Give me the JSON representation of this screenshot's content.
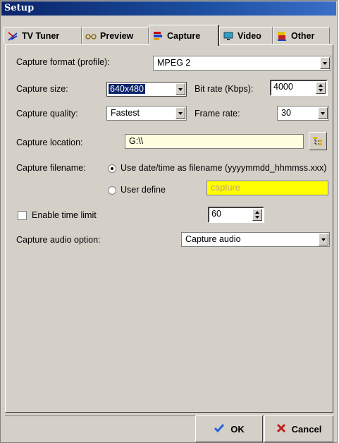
{
  "window": {
    "title": "Setup"
  },
  "tabs": [
    {
      "label": "TV Tuner",
      "icon": "antenna-icon"
    },
    {
      "label": "Preview",
      "icon": "glasses-icon"
    },
    {
      "label": "Capture",
      "icon": "capture-icon"
    },
    {
      "label": "Video",
      "icon": "monitor-icon"
    },
    {
      "label": "Other",
      "icon": "other-icon"
    }
  ],
  "active_tab": "Capture",
  "capture": {
    "format_label": "Capture format (profile):",
    "format_value": "MPEG 2",
    "size_label": "Capture size:",
    "size_value": "640x480",
    "bitrate_label": "Bit rate (Kbps):",
    "bitrate_value": "4000",
    "quality_label": "Capture quality:",
    "quality_value": "Fastest",
    "framerate_label": "Frame rate:",
    "framerate_value": "30",
    "location_label": "Capture location:",
    "location_value": "G:\\\\",
    "filename_label": "Capture filename:",
    "filename_option_date": "Use date/time as filename (yyyymmdd_hhmmss.xxx)",
    "filename_option_user": "User define",
    "filename_user_value": "capture",
    "time_limit_label": "Enable time limit",
    "time_limit_value": "60",
    "audio_label": "Capture audio option:",
    "audio_value": "Capture audio"
  },
  "buttons": {
    "ok": "OK",
    "cancel": "Cancel"
  },
  "colors": {
    "title_bar": "#0a246a",
    "location_field": "#ffffe0",
    "user_field": "#ffff00",
    "ok_check": "#2a62d8",
    "cancel_x": "#c02020"
  }
}
